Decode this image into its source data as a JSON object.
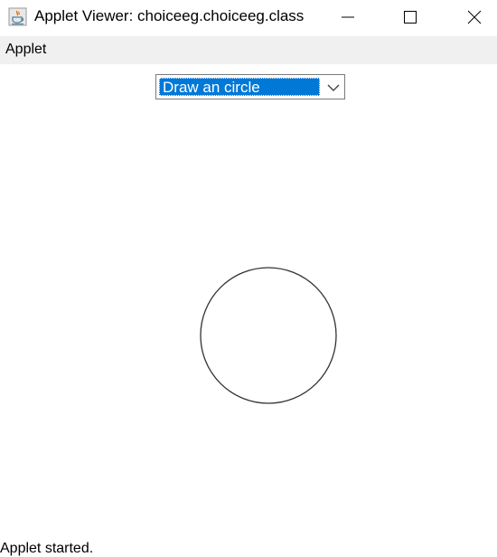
{
  "window": {
    "title": "Applet Viewer: choiceeg.choiceeg.class"
  },
  "icons": {
    "app": "java-applet-icon",
    "minimize": "minimize-icon",
    "maximize": "maximize-icon",
    "close": "close-icon",
    "dropdown": "chevron-down-icon"
  },
  "menu": {
    "items": [
      {
        "label": "Applet"
      }
    ]
  },
  "choice": {
    "selected": "Draw an circle"
  },
  "status": {
    "text": "Applet started."
  },
  "colors": {
    "selection": "#0078d7",
    "menubar": "#f0f0f0",
    "shape_stroke": "#333333"
  }
}
